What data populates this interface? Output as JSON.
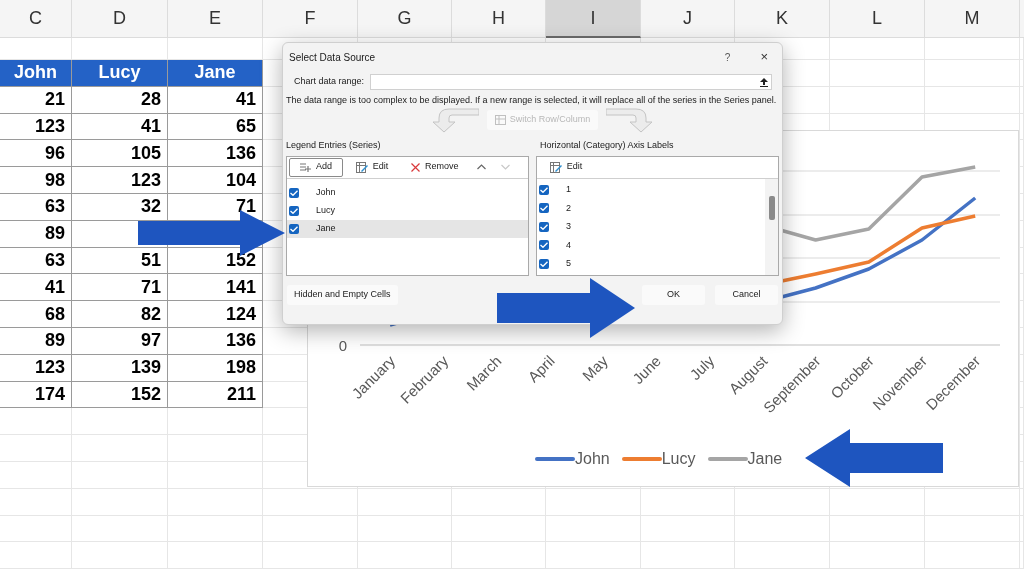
{
  "column_headers": [
    {
      "label": "C",
      "selected": false
    },
    {
      "label": "D",
      "selected": false
    },
    {
      "label": "E",
      "selected": false
    },
    {
      "label": "F",
      "selected": false
    },
    {
      "label": "G",
      "selected": false
    },
    {
      "label": "H",
      "selected": false
    },
    {
      "label": "I",
      "selected": true
    },
    {
      "label": "J",
      "selected": false
    },
    {
      "label": "K",
      "selected": false
    },
    {
      "label": "L",
      "selected": false
    },
    {
      "label": "M",
      "selected": false
    }
  ],
  "table": {
    "columns": [
      "John",
      "Lucy",
      "Jane"
    ],
    "rows": [
      [
        "21",
        "28",
        "41"
      ],
      [
        "123",
        "41",
        "65"
      ],
      [
        "96",
        "105",
        "136"
      ],
      [
        "98",
        "123",
        "104"
      ],
      [
        "63",
        "32",
        "71"
      ],
      [
        "89"
      ],
      [
        "63",
        "51",
        "152"
      ],
      [
        "41",
        "71",
        "141"
      ],
      [
        "68",
        "82",
        "124"
      ],
      [
        "89",
        "97",
        "136"
      ],
      [
        "123",
        "139",
        "198"
      ],
      [
        "174",
        "152",
        "211"
      ]
    ]
  },
  "chart": {
    "y_axis_label": "0",
    "categories": [
      "January",
      "February",
      "March",
      "April",
      "May",
      "June",
      "July",
      "August",
      "September",
      "October",
      "November",
      "December"
    ],
    "legend": [
      {
        "name": "John",
        "color": "#4472c4"
      },
      {
        "name": "Lucy",
        "color": "#ed7d31"
      },
      {
        "name": "Jane",
        "color": "#a5a5a5"
      }
    ]
  },
  "dialog": {
    "title": "Select Data Source",
    "help": "?",
    "close": "×",
    "range_label": "Chart data range:",
    "message": "The data range is too complex to be displayed. If a new range is selected, it will replace all of the series in the Series panel.",
    "switch_button": {
      "label": "Switch Row/Column",
      "disabled": true
    },
    "legend_label": "Legend Entries (Series)",
    "legend_toolbar": [
      {
        "kind": "add",
        "label": "Add",
        "disabled": false
      },
      {
        "kind": "edit",
        "label": "Edit",
        "disabled": false
      },
      {
        "kind": "remove",
        "label": "Remove",
        "disabled": false
      },
      {
        "kind": "up",
        "disabled": false
      },
      {
        "kind": "down",
        "disabled": true
      }
    ],
    "series": [
      {
        "name": "John",
        "checked": true,
        "selected": false
      },
      {
        "name": "Lucy",
        "checked": true,
        "selected": false
      },
      {
        "name": "Jane",
        "checked": true,
        "selected": true
      }
    ],
    "axis_label": "Horizontal (Category) Axis Labels",
    "axis_toolbar": [
      {
        "kind": "edit",
        "label": "Edit",
        "disabled": false
      }
    ],
    "axis_items": [
      {
        "label": "1",
        "checked": true
      },
      {
        "label": "2",
        "checked": true
      },
      {
        "label": "3",
        "checked": true
      },
      {
        "label": "4",
        "checked": true
      },
      {
        "label": "5",
        "checked": true
      }
    ],
    "hidden_button": "Hidden and Empty Cells",
    "ok_button": "OK",
    "cancel_button": "Cancel"
  }
}
